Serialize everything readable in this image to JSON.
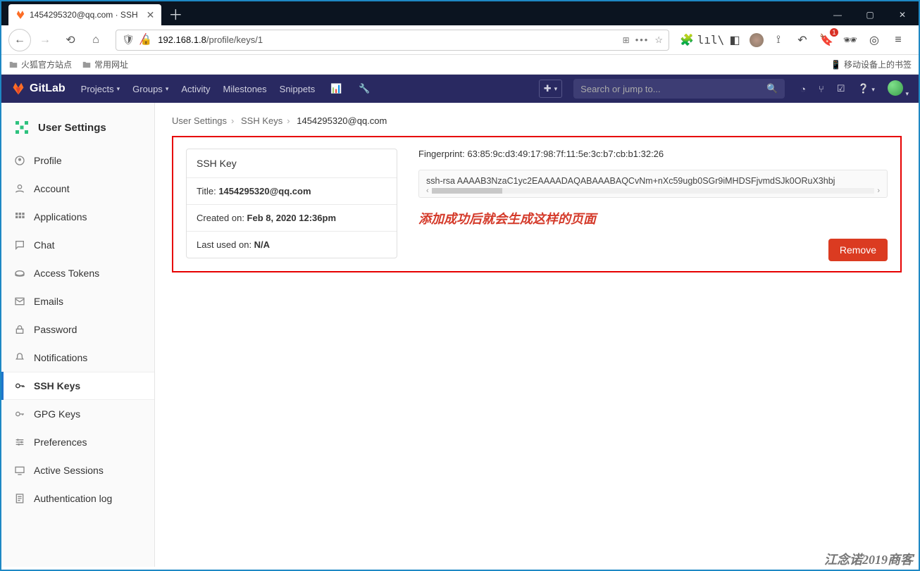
{
  "browser": {
    "tab_title": "1454295320@qq.com · SSH",
    "url_host": "192.168.1.8",
    "url_path": "/profile/keys/1",
    "bookmarks": {
      "b1": "火狐官方站点",
      "b2": "常用网址",
      "mobile": "移动设备上的书签"
    }
  },
  "gitlab": {
    "brand": "GitLab",
    "nav": {
      "projects": "Projects",
      "groups": "Groups",
      "activity": "Activity",
      "milestones": "Milestones",
      "snippets": "Snippets"
    },
    "search_placeholder": "Search or jump to..."
  },
  "sidebar": {
    "title": "User Settings",
    "items": {
      "profile": "Profile",
      "account": "Account",
      "applications": "Applications",
      "chat": "Chat",
      "tokens": "Access Tokens",
      "emails": "Emails",
      "password": "Password",
      "notifications": "Notifications",
      "ssh": "SSH Keys",
      "gpg": "GPG Keys",
      "preferences": "Preferences",
      "sessions": "Active Sessions",
      "authlog": "Authentication log"
    }
  },
  "breadcrumb": {
    "a": "User Settings",
    "b": "SSH Keys",
    "c": "1454295320@qq.com"
  },
  "card": {
    "header": "SSH Key",
    "title_label": "Title: ",
    "title_value": "1454295320@qq.com",
    "created_label": "Created on: ",
    "created_value": "Feb 8, 2020 12:36pm",
    "last_label": "Last used on: ",
    "last_value": "N/A"
  },
  "detail": {
    "fp_label": "Fingerprint: ",
    "fp_value": "63:85:9c:d3:49:17:98:7f:11:5e:3c:b7:cb:b1:32:26",
    "key_text": "ssh-rsa AAAAB3NzaC1yc2EAAAADAQABAAABAQCvNm+nXc59ugb0SGr9iMHDSFjvmdSJk0ORuX3hbj",
    "annotation": "添加成功后就会生成这样的页面",
    "remove": "Remove"
  },
  "watermark": "江念诺2019商客"
}
